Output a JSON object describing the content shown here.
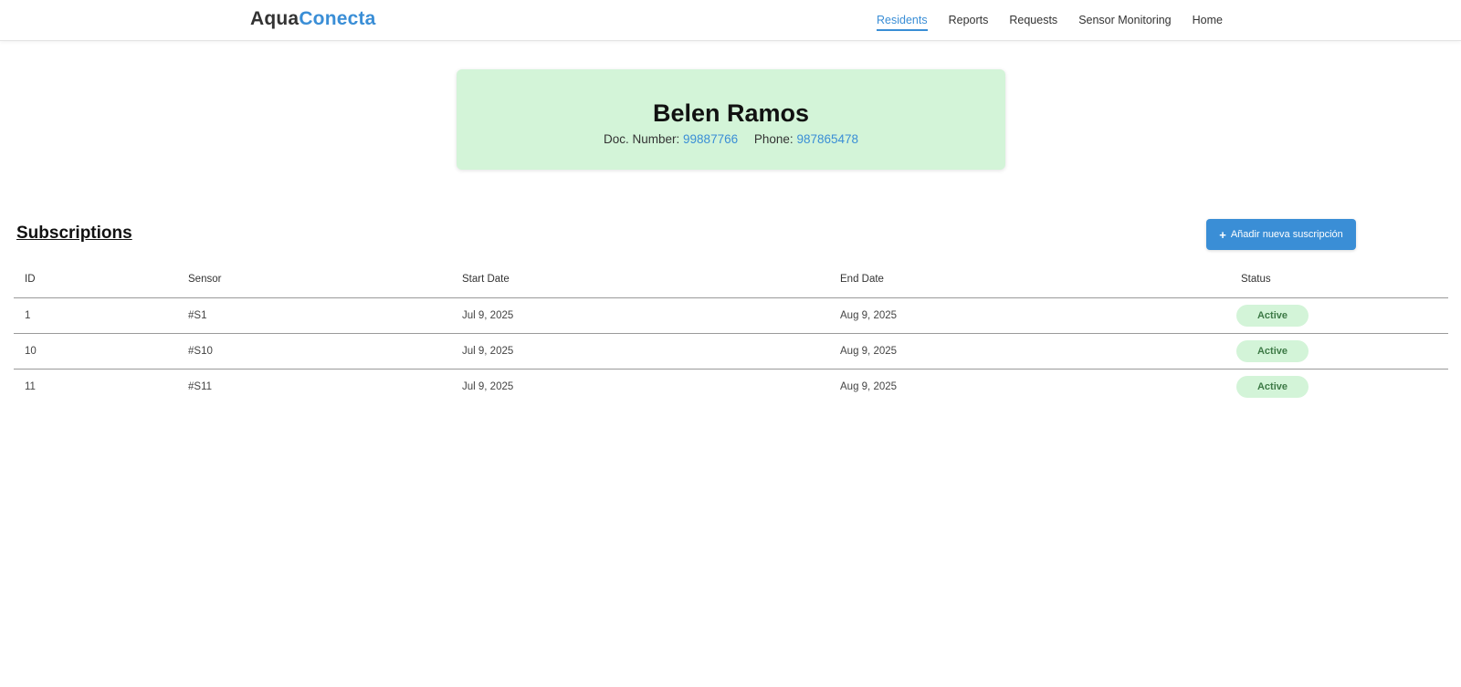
{
  "brand": {
    "part1": "Aqua",
    "part2": "Conecta"
  },
  "nav": {
    "items": [
      {
        "label": "Residents",
        "active": true
      },
      {
        "label": "Reports",
        "active": false
      },
      {
        "label": "Requests",
        "active": false
      },
      {
        "label": "Sensor Monitoring",
        "active": false
      },
      {
        "label": "Home",
        "active": false
      }
    ]
  },
  "resident": {
    "name": "Belen Ramos",
    "doc_label": "Doc. Number:",
    "doc_value": "99887766",
    "phone_label": "Phone:",
    "phone_value": "987865478"
  },
  "subscriptions": {
    "title": "Subscriptions",
    "add_button_label": "Añadir nueva suscripción",
    "add_button_icon": "plus-icon",
    "columns": [
      "ID",
      "Sensor",
      "Start Date",
      "End Date",
      "Status"
    ],
    "rows": [
      {
        "id": "1",
        "sensor": "#S1",
        "start": "Jul 9, 2025",
        "end": "Aug 9, 2025",
        "status": "Active"
      },
      {
        "id": "10",
        "sensor": "#S10",
        "start": "Jul 9, 2025",
        "end": "Aug 9, 2025",
        "status": "Active"
      },
      {
        "id": "11",
        "sensor": "#S11",
        "start": "Jul 9, 2025",
        "end": "Aug 9, 2025",
        "status": "Active"
      }
    ]
  },
  "colors": {
    "accent": "#3a8ed6",
    "card_bg": "#d3f4d8",
    "status_text": "#3d7a46"
  }
}
